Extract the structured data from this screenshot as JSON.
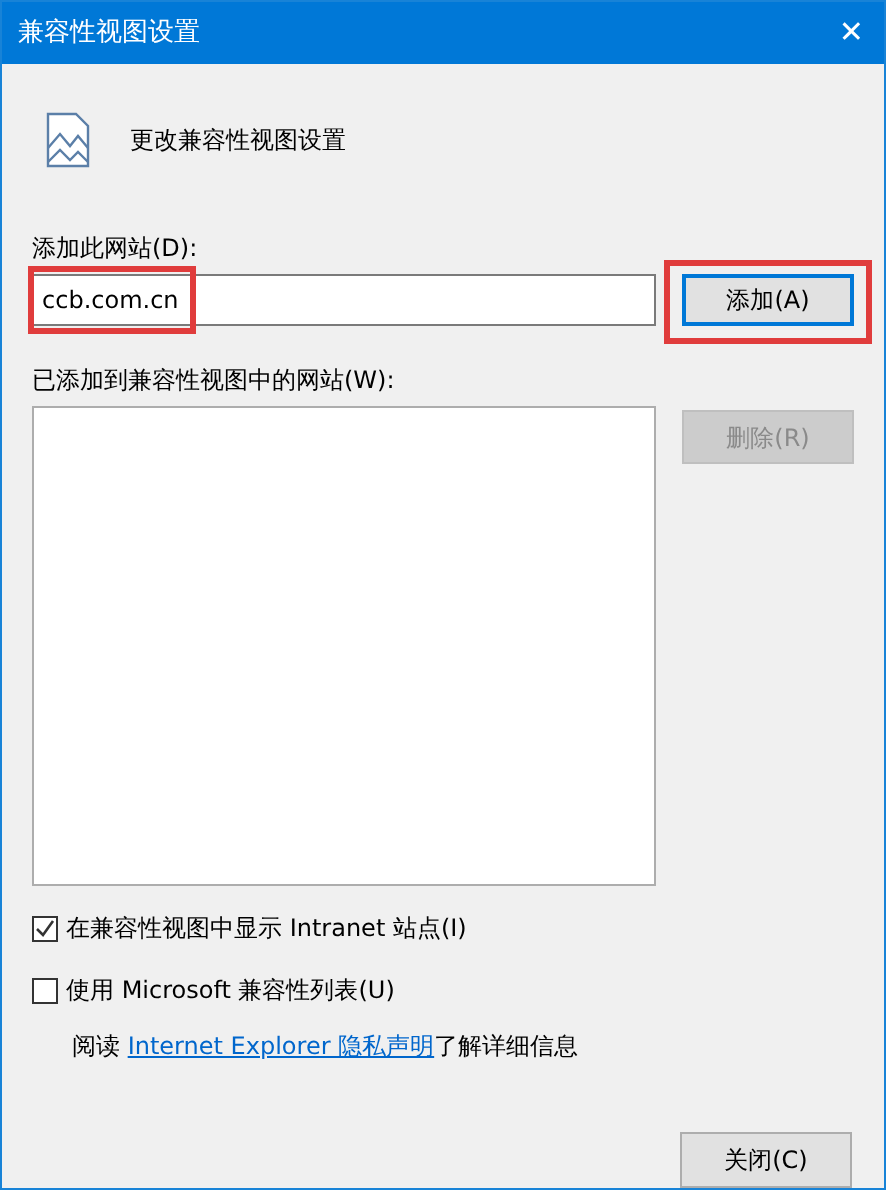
{
  "window": {
    "title": "兼容性视图设置",
    "close": "✕"
  },
  "header": "更改兼容性视图设置",
  "add_site": {
    "label": "添加此网站(D):",
    "value": "ccb.com.cn",
    "button": "添加(A)",
    "highlighted": true
  },
  "sites_list": {
    "label": "已添加到兼容性视图中的网站(W):",
    "remove_button": {
      "label": "删除(R)",
      "disabled": true
    }
  },
  "options": [
    {
      "label": "在兼容性视图中显示 Intranet 站点(I)",
      "checked": true
    },
    {
      "label": "使用 Microsoft 兼容性列表(U)",
      "checked": false
    }
  ],
  "privacy_note": {
    "before": "阅读 ",
    "link": "Internet Explorer 隐私声明",
    "after": "了解详细信息"
  },
  "close_button": "关闭(C)"
}
